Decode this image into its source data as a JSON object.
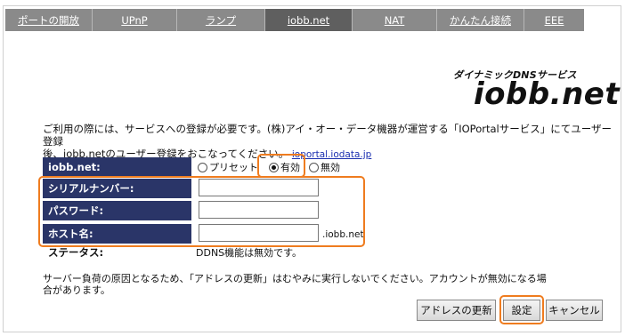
{
  "tabs": [
    {
      "label": "ポートの開放",
      "active": false
    },
    {
      "label": "UPnP",
      "active": false
    },
    {
      "label": "ランプ",
      "active": false
    },
    {
      "label": "iobb.net",
      "active": true
    },
    {
      "label": "NAT",
      "active": false
    },
    {
      "label": "かんたん接続",
      "active": false
    },
    {
      "label": "EEE",
      "active": false
    }
  ],
  "brand": {
    "subtitle": "ダイナミックDNSサービス",
    "logo": "iobb.net"
  },
  "intro": {
    "line1": "ご利用の際には、サービスへの登録が必要です。(株)アイ・オー・データ機器が運営する「IOPortalサービス」にてユーザー登録",
    "line2": "後、iobb.netのユーザー登録をおこなってください。",
    "link": "ioportal.iodata.jp"
  },
  "form": {
    "iobbnet_label": "iobb.net:",
    "options": [
      "プリセット",
      "有効",
      "無効"
    ],
    "selected_option": "有効",
    "serial_label": "シリアルナンバー:",
    "serial_value": "",
    "password_label": "パスワード:",
    "password_value": "",
    "host_label": "ホスト名:",
    "host_value": "",
    "host_suffix": ".iobb.net",
    "status_label": "ステータス:",
    "status_value": "DDNS機能は無効です。"
  },
  "notice": {
    "line1": "サーバー負荷の原因となるため、「アドレスの更新」はむやみに実行しないでください。アカウントが無効になる場",
    "line2": "合があります。"
  },
  "buttons": {
    "update": "アドレスの更新",
    "save": "設定",
    "cancel": "キャンセル"
  },
  "colors": {
    "tab_bg": "#8a8a8a",
    "tab_active": "#5f5f5f",
    "label_bg": "#2a3568",
    "highlight": "#ef7c1f",
    "link": "#1a2fb0"
  }
}
